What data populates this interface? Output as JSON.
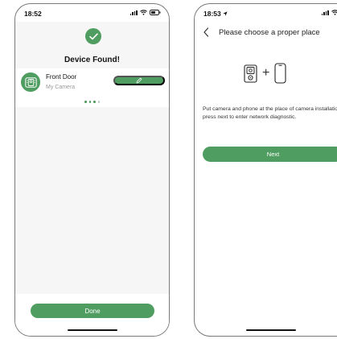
{
  "screen1": {
    "time": "18:52",
    "title": "Device Found!",
    "device": {
      "name": "Front Door",
      "subtitle": "My Camera"
    },
    "pager": {
      "total": 4,
      "active_index": 0
    },
    "done_label": "Done"
  },
  "screen2": {
    "time": "18:53",
    "header_title": "Please choose a proper place",
    "description": "Put camera and phone at the place of camera installation, press next to enter network diagnostic.",
    "hero_separator": "+",
    "next_label": "Next"
  },
  "colors": {
    "accent": "#4f9d60",
    "screen_bg": "#f6f6f6"
  },
  "icons": [
    "check-icon",
    "camera-device-icon",
    "pencil-icon",
    "back-chevron-icon",
    "speaker-icon",
    "doorbell-camera-icon",
    "phone-icon",
    "signal-icon",
    "wifi-icon",
    "battery-icon",
    "location-arrow-icon"
  ]
}
